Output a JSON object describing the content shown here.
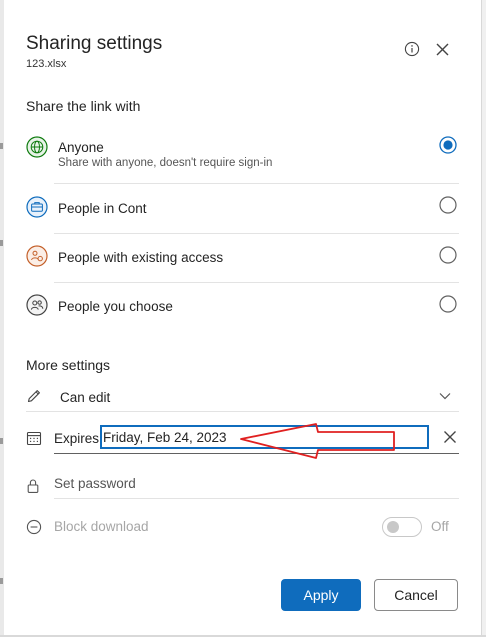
{
  "dialog": {
    "title": "Sharing settings",
    "filename": "123.xlsx"
  },
  "share_section": {
    "label": "Share the link with",
    "options": [
      {
        "label": "Anyone",
        "description": "Share with anyone, doesn't require sign-in",
        "selected": true,
        "icon": "globe-icon",
        "icon_color": "#107c10"
      },
      {
        "label": "People in Cont",
        "selected": false,
        "icon": "briefcase-icon",
        "icon_color": "#0f6cbd"
      },
      {
        "label": "People with existing access",
        "selected": false,
        "icon": "people-existing-icon",
        "icon_color": "#c4602a"
      },
      {
        "label": "People you choose",
        "selected": false,
        "icon": "people-choose-icon",
        "icon_color": "#444444"
      }
    ]
  },
  "more_settings": {
    "label": "More settings",
    "permission": {
      "label": "Can edit",
      "icon": "pencil-icon"
    },
    "expires": {
      "label": "Expires",
      "value": "Friday, Feb 24, 2023",
      "icon": "calendar-icon"
    },
    "password": {
      "placeholder": "Set password",
      "icon": "lock-icon"
    },
    "block_download": {
      "label": "Block download",
      "toggle_text": "Off",
      "on": false,
      "icon": "block-icon"
    }
  },
  "buttons": {
    "apply": "Apply",
    "cancel": "Cancel"
  },
  "colors": {
    "accent": "#0f6cbd",
    "annotation": "#e02020"
  }
}
